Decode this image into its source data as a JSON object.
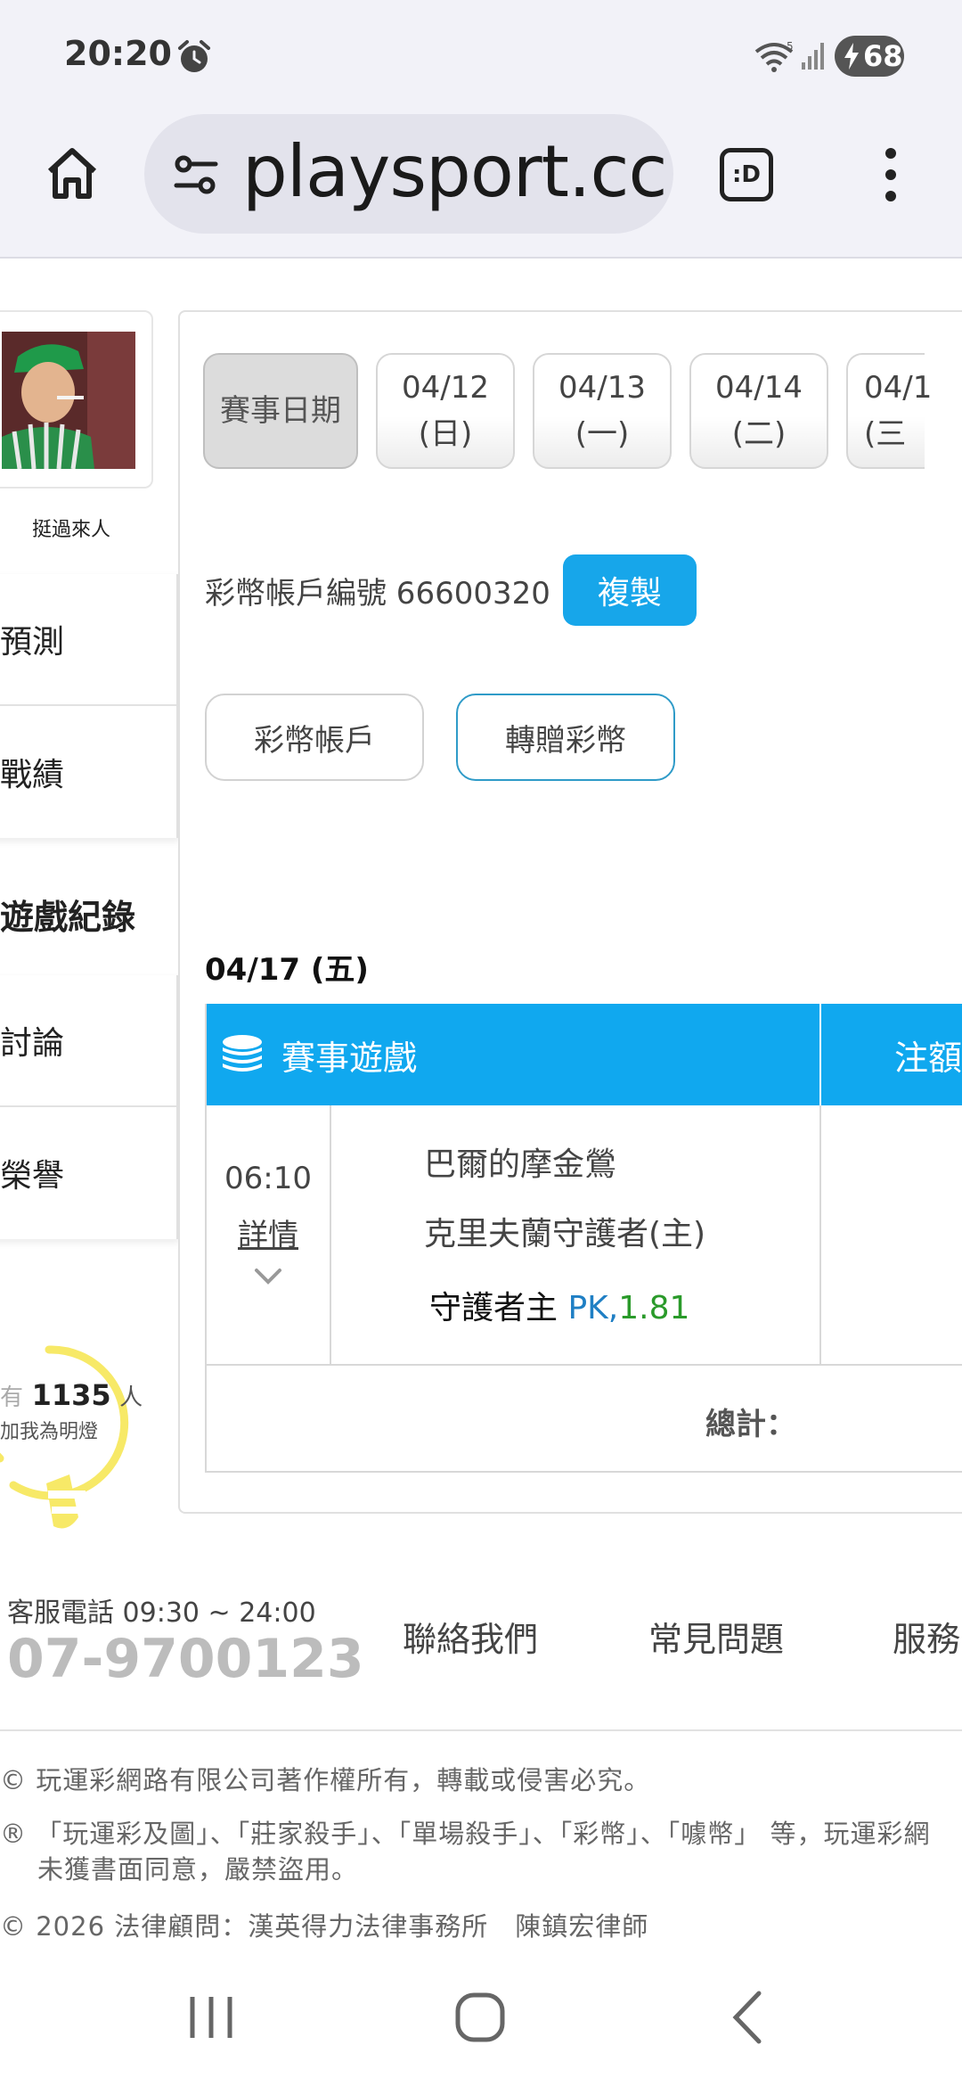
{
  "status_bar": {
    "time": "20:20",
    "battery": "68",
    "icons": [
      "alarm-icon",
      "wifi-icon",
      "signal-icon",
      "battery-charging-icon"
    ]
  },
  "browser": {
    "url": "playsport.cc",
    "tab_label": ":D",
    "icons": [
      "home-icon",
      "site-settings-icon",
      "tab-switcher-icon",
      "more-vert-icon"
    ]
  },
  "sidebar": {
    "user_name": "挺過來人",
    "items_top": [
      "預測",
      "戰績"
    ],
    "active_item": "遊戲紀錄",
    "items_bottom": [
      "討論",
      "榮譽"
    ],
    "fans_prefix": "有",
    "fans_count": "1135",
    "fans_unit": "人",
    "fans_caption": "加我為明燈"
  },
  "date_tabs": {
    "label": "賽事日期",
    "dates": [
      {
        "date": "04/12",
        "weekday": "(日)"
      },
      {
        "date": "04/13",
        "weekday": "(一)"
      },
      {
        "date": "04/14",
        "weekday": "(二)"
      },
      {
        "date": "04/1",
        "weekday": "(三"
      }
    ]
  },
  "account": {
    "label": "彩幣帳戶編號 66600320",
    "copy_button": "複製",
    "buttons": [
      "彩幣帳戶",
      "轉贈彩幣"
    ]
  },
  "records": {
    "day": "04/17 (五)",
    "header_game": "賽事遊戲",
    "header_bet": "注額",
    "rows": [
      {
        "time": "06:10",
        "detail": "詳情",
        "away": "巴爾的摩金鶯",
        "home": "克里夫蘭守護者(主)",
        "pick": "守護者主",
        "pick_type": "PK,",
        "odds": "1.81"
      }
    ],
    "total_label": "總計："
  },
  "footer": {
    "hotline_label": "客服電話 09:30 ~ 24:00",
    "hotline_number": "07-9700123",
    "links": [
      "聯絡我們",
      "常見問題",
      "服務"
    ],
    "copyright": "© 玩運彩網路有限公司著作權所有，轉載或侵害必究。",
    "trademark_1": "® 「玩運彩及圖」、「莊家殺手」、「單場殺手」、「彩幣」、「噱幣」 等，玩運彩網",
    "trademark_2": "未獲書面同意，嚴禁盜用。",
    "legal": "© 2026 法律顧問：漢英得力法律事務所　陳鎮宏律師"
  },
  "colors": {
    "accent_blue": "#10a8ef",
    "copy_button": "#17a6ea",
    "pk_text": "#1f7fc4",
    "odds_text": "#2a9a2a",
    "hotline_gray": "#bcbcbc",
    "bulb_yellow": "#f7e967"
  },
  "navbar": {
    "icons": [
      "recent-apps-icon",
      "home-circle-icon",
      "back-icon"
    ]
  }
}
